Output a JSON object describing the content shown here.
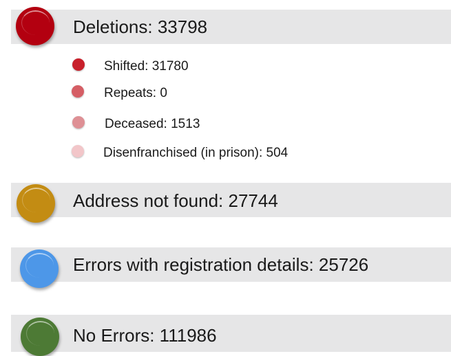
{
  "groups": [
    {
      "label": "Deletions: 33798",
      "color": "#b30010",
      "items": [
        {
          "label": "Shifted: 31780",
          "color": "#c8202b"
        },
        {
          "label": "Repeats: 0",
          "color": "#d55e65"
        },
        {
          "label": "Deceased: 1513",
          "color": "#de9095"
        },
        {
          "label": "Disenfranchised (in prison): 504",
          "color": "#f2c6c9"
        }
      ]
    },
    {
      "label": "Address not found: 27744",
      "color": "#c38c13",
      "items": []
    },
    {
      "label": "Errors with registration details: 25726",
      "color": "#4d97e8",
      "items": []
    },
    {
      "label": "No Errors: 111986",
      "color": "#4d7a35",
      "items": []
    }
  ]
}
